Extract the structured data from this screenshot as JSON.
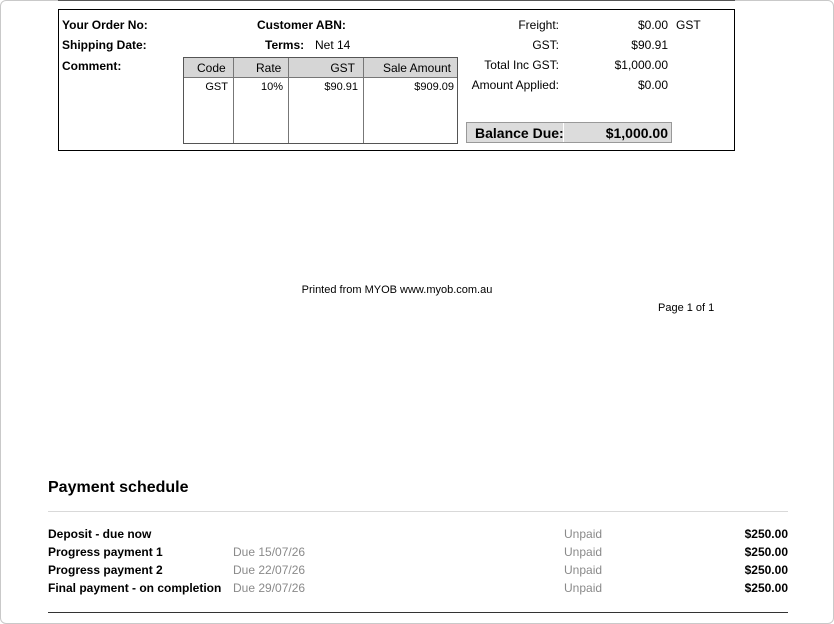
{
  "order": {
    "order_no_label": "Your Order No:",
    "shipping_date_label": "Shipping Date:",
    "comment_label": "Comment:",
    "customer_abn_label": "Customer ABN:",
    "terms_label": "Terms:",
    "terms_value": "Net 14"
  },
  "tax_table": {
    "headers": [
      "Code",
      "Rate",
      "GST",
      "Sale Amount"
    ],
    "rows": [
      [
        "GST",
        "10%",
        "$90.91",
        "$909.09"
      ]
    ]
  },
  "totals": {
    "freight_label": "Freight:",
    "freight_value": "$0.00",
    "freight_code": "GST",
    "gst_label": "GST:",
    "gst_value": "$90.91",
    "total_inc_label": "Total Inc GST:",
    "total_inc_value": "$1,000.00",
    "amount_applied_label": "Amount Applied:",
    "amount_applied_value": "$0.00",
    "balance_label": "Balance Due:",
    "balance_value": "$1,000.00"
  },
  "footer": {
    "printed_from": "Printed from MYOB www.myob.com.au",
    "page": "Page 1 of 1"
  },
  "payment_schedule": {
    "title": "Payment schedule",
    "items": [
      {
        "name": "Deposit - due now",
        "due": "",
        "status": "Unpaid",
        "amount": "$250.00"
      },
      {
        "name": "Progress payment 1",
        "due": "Due 15/07/26",
        "status": "Unpaid",
        "amount": "$250.00"
      },
      {
        "name": "Progress payment 2",
        "due": "Due 22/07/26",
        "status": "Unpaid",
        "amount": "$250.00"
      },
      {
        "name": "Final payment - on completion",
        "due": "Due 29/07/26",
        "status": "Unpaid",
        "amount": "$250.00"
      }
    ]
  }
}
